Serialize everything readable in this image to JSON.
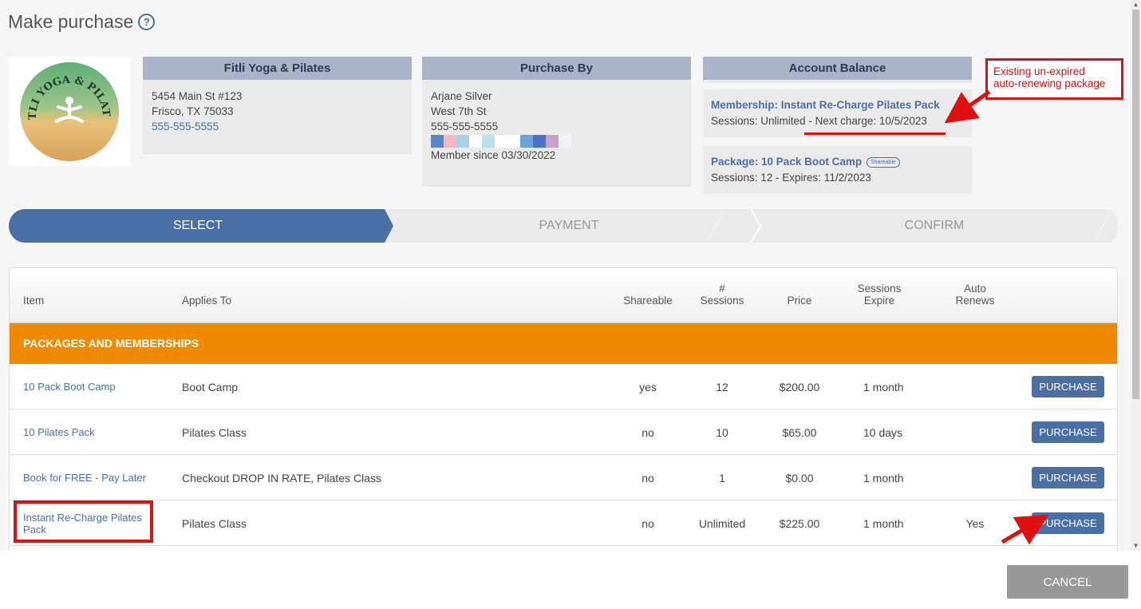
{
  "page": {
    "title": "Make purchase",
    "help_icon": "question-circle-icon"
  },
  "logo": {
    "brand_text": "FITLI YOGA & PILATES"
  },
  "studio": {
    "header": "Fitli Yoga & Pilates",
    "address1": "5454 Main St #123",
    "address2": "Frisco, TX 75033",
    "phone": "555-555-5555"
  },
  "purchaser": {
    "header": "Purchase By",
    "name": "Arjane Silver",
    "street": "West 7th St",
    "phone": "555-555-5555",
    "member_since": "Member since 03/30/2022",
    "swatch_colors": [
      "#5b86c5",
      "#f2b8c6",
      "#a8d3ea",
      "#ffffff",
      "#b6e3ea",
      "#ffffff",
      "#ffffff",
      "#6ba2d8",
      "#4a73c0",
      "#c2a2cc",
      "#eef4f8"
    ]
  },
  "balance": {
    "header": "Account Balance",
    "membership": {
      "name": "Membership: Instant Re-Charge Pilates Pack",
      "sessions": "Sessions: Unlimited -",
      "next_charge": "Next charge: 10/5/2023"
    },
    "package": {
      "name": "Package: 10 Pack Boot Camp",
      "shareable_badge": "Shareable",
      "details": "Sessions: 12 - Expires: 11/2/2023"
    }
  },
  "callout": {
    "line1": "Existing un-expired",
    "line2": "auto-renewing package",
    "color": "#e01010"
  },
  "steps": {
    "select": "SELECT",
    "payment": "PAYMENT",
    "confirm": "CONFIRM",
    "active": "SELECT",
    "active_color": "#4a6fa5"
  },
  "table": {
    "columns": {
      "item": "Item",
      "applies_to": "Applies To",
      "shareable": "Shareable",
      "sessions_l1": "#",
      "sessions_l2": "Sessions",
      "price": "Price",
      "expire_l1": "Sessions",
      "expire_l2": "Expire",
      "renew_l1": "Auto",
      "renew_l2": "Renews"
    },
    "section": "PACKAGES AND MEMBERSHIPS",
    "section_color": "#f08a00",
    "rows": [
      {
        "item": "10 Pack Boot Camp",
        "applies_to": "Boot Camp",
        "shareable": "yes",
        "sessions": "12",
        "price": "$200.00",
        "expires": "1 month",
        "auto_renews": "",
        "action": "PURCHASE"
      },
      {
        "item": "10 Pilates Pack",
        "applies_to": "Pilates Class",
        "shareable": "no",
        "sessions": "10",
        "price": "$65.00",
        "expires": "10 days",
        "auto_renews": "",
        "action": "PURCHASE"
      },
      {
        "item": "Book for FREE - Pay Later",
        "applies_to": "Checkout DROP IN RATE, Pilates Class",
        "shareable": "no",
        "sessions": "1",
        "price": "$0.00",
        "expires": "1 month",
        "auto_renews": "",
        "action": "PURCHASE"
      },
      {
        "item": "Instant Re-Charge Pilates Pack",
        "applies_to": "Pilates Class",
        "shareable": "no",
        "sessions": "Unlimited",
        "price": "$225.00",
        "expires": "1 month",
        "auto_renews": "Yes",
        "action": "PURCHASE"
      }
    ]
  },
  "footer": {
    "cancel": "CANCEL"
  }
}
